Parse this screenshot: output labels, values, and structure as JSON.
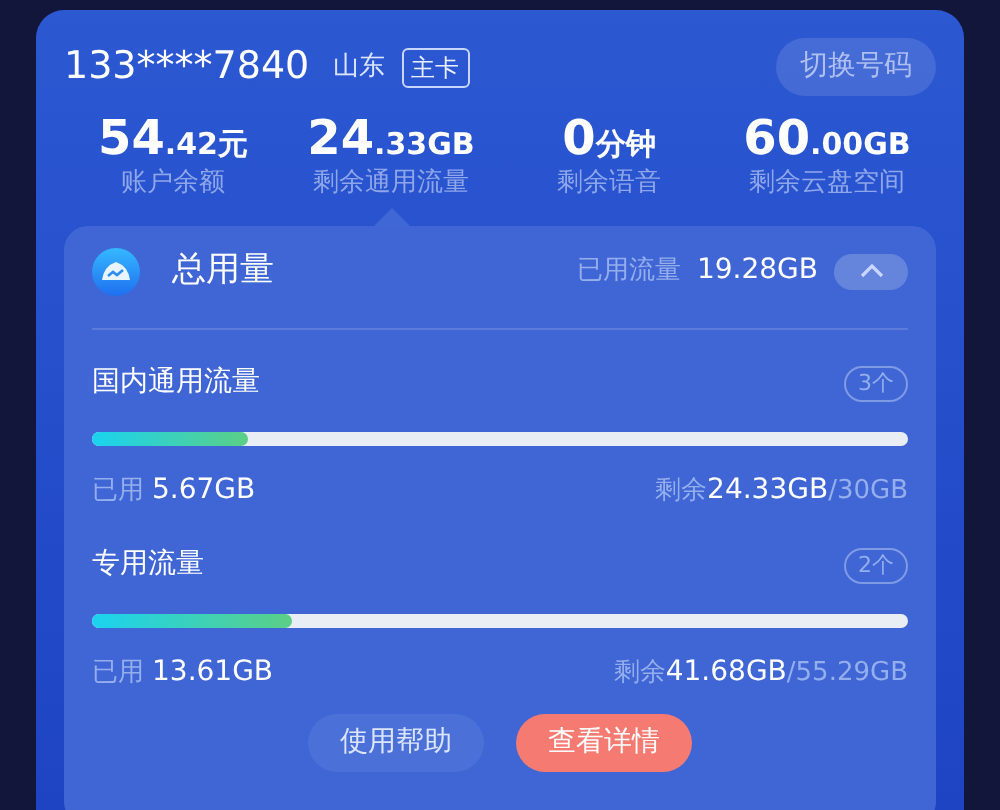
{
  "account": {
    "phone": "133****7840",
    "province": "山东",
    "tag": "主卡",
    "switch_button": "切换号码"
  },
  "stats": [
    {
      "main": "54",
      "unit": ".42元",
      "label": "账户余额",
      "selected": false
    },
    {
      "main": "24",
      "unit": ".33GB",
      "label": "剩余通用流量",
      "selected": true
    },
    {
      "main": "0",
      "unit": "分钟",
      "label": "剩余语音",
      "selected": false
    },
    {
      "main": "60",
      "unit": ".00GB",
      "label": "剩余云盘空间",
      "selected": false
    }
  ],
  "usage_panel": {
    "title": "总用量",
    "used_label": "已用流量",
    "used_value": "19.28GB",
    "expanded": true,
    "sections": [
      {
        "name": "国内通用流量",
        "count": "3个",
        "level": 0.19,
        "used_label": "已用",
        "used": "5.67GB",
        "remain_label": "剩余",
        "remain": "24.33GB",
        "total": "/30GB"
      },
      {
        "name": "专用流量",
        "count": "2个",
        "level": 0.246,
        "used_label": "已用",
        "used": "13.61GB",
        "remain_label": "剩余",
        "remain": "41.68GB",
        "total": "/55.29GB"
      }
    ]
  },
  "buttons": [
    {
      "label": "使用帮助",
      "kind": "secondary"
    },
    {
      "label": "查看详情",
      "kind": "primary"
    }
  ]
}
